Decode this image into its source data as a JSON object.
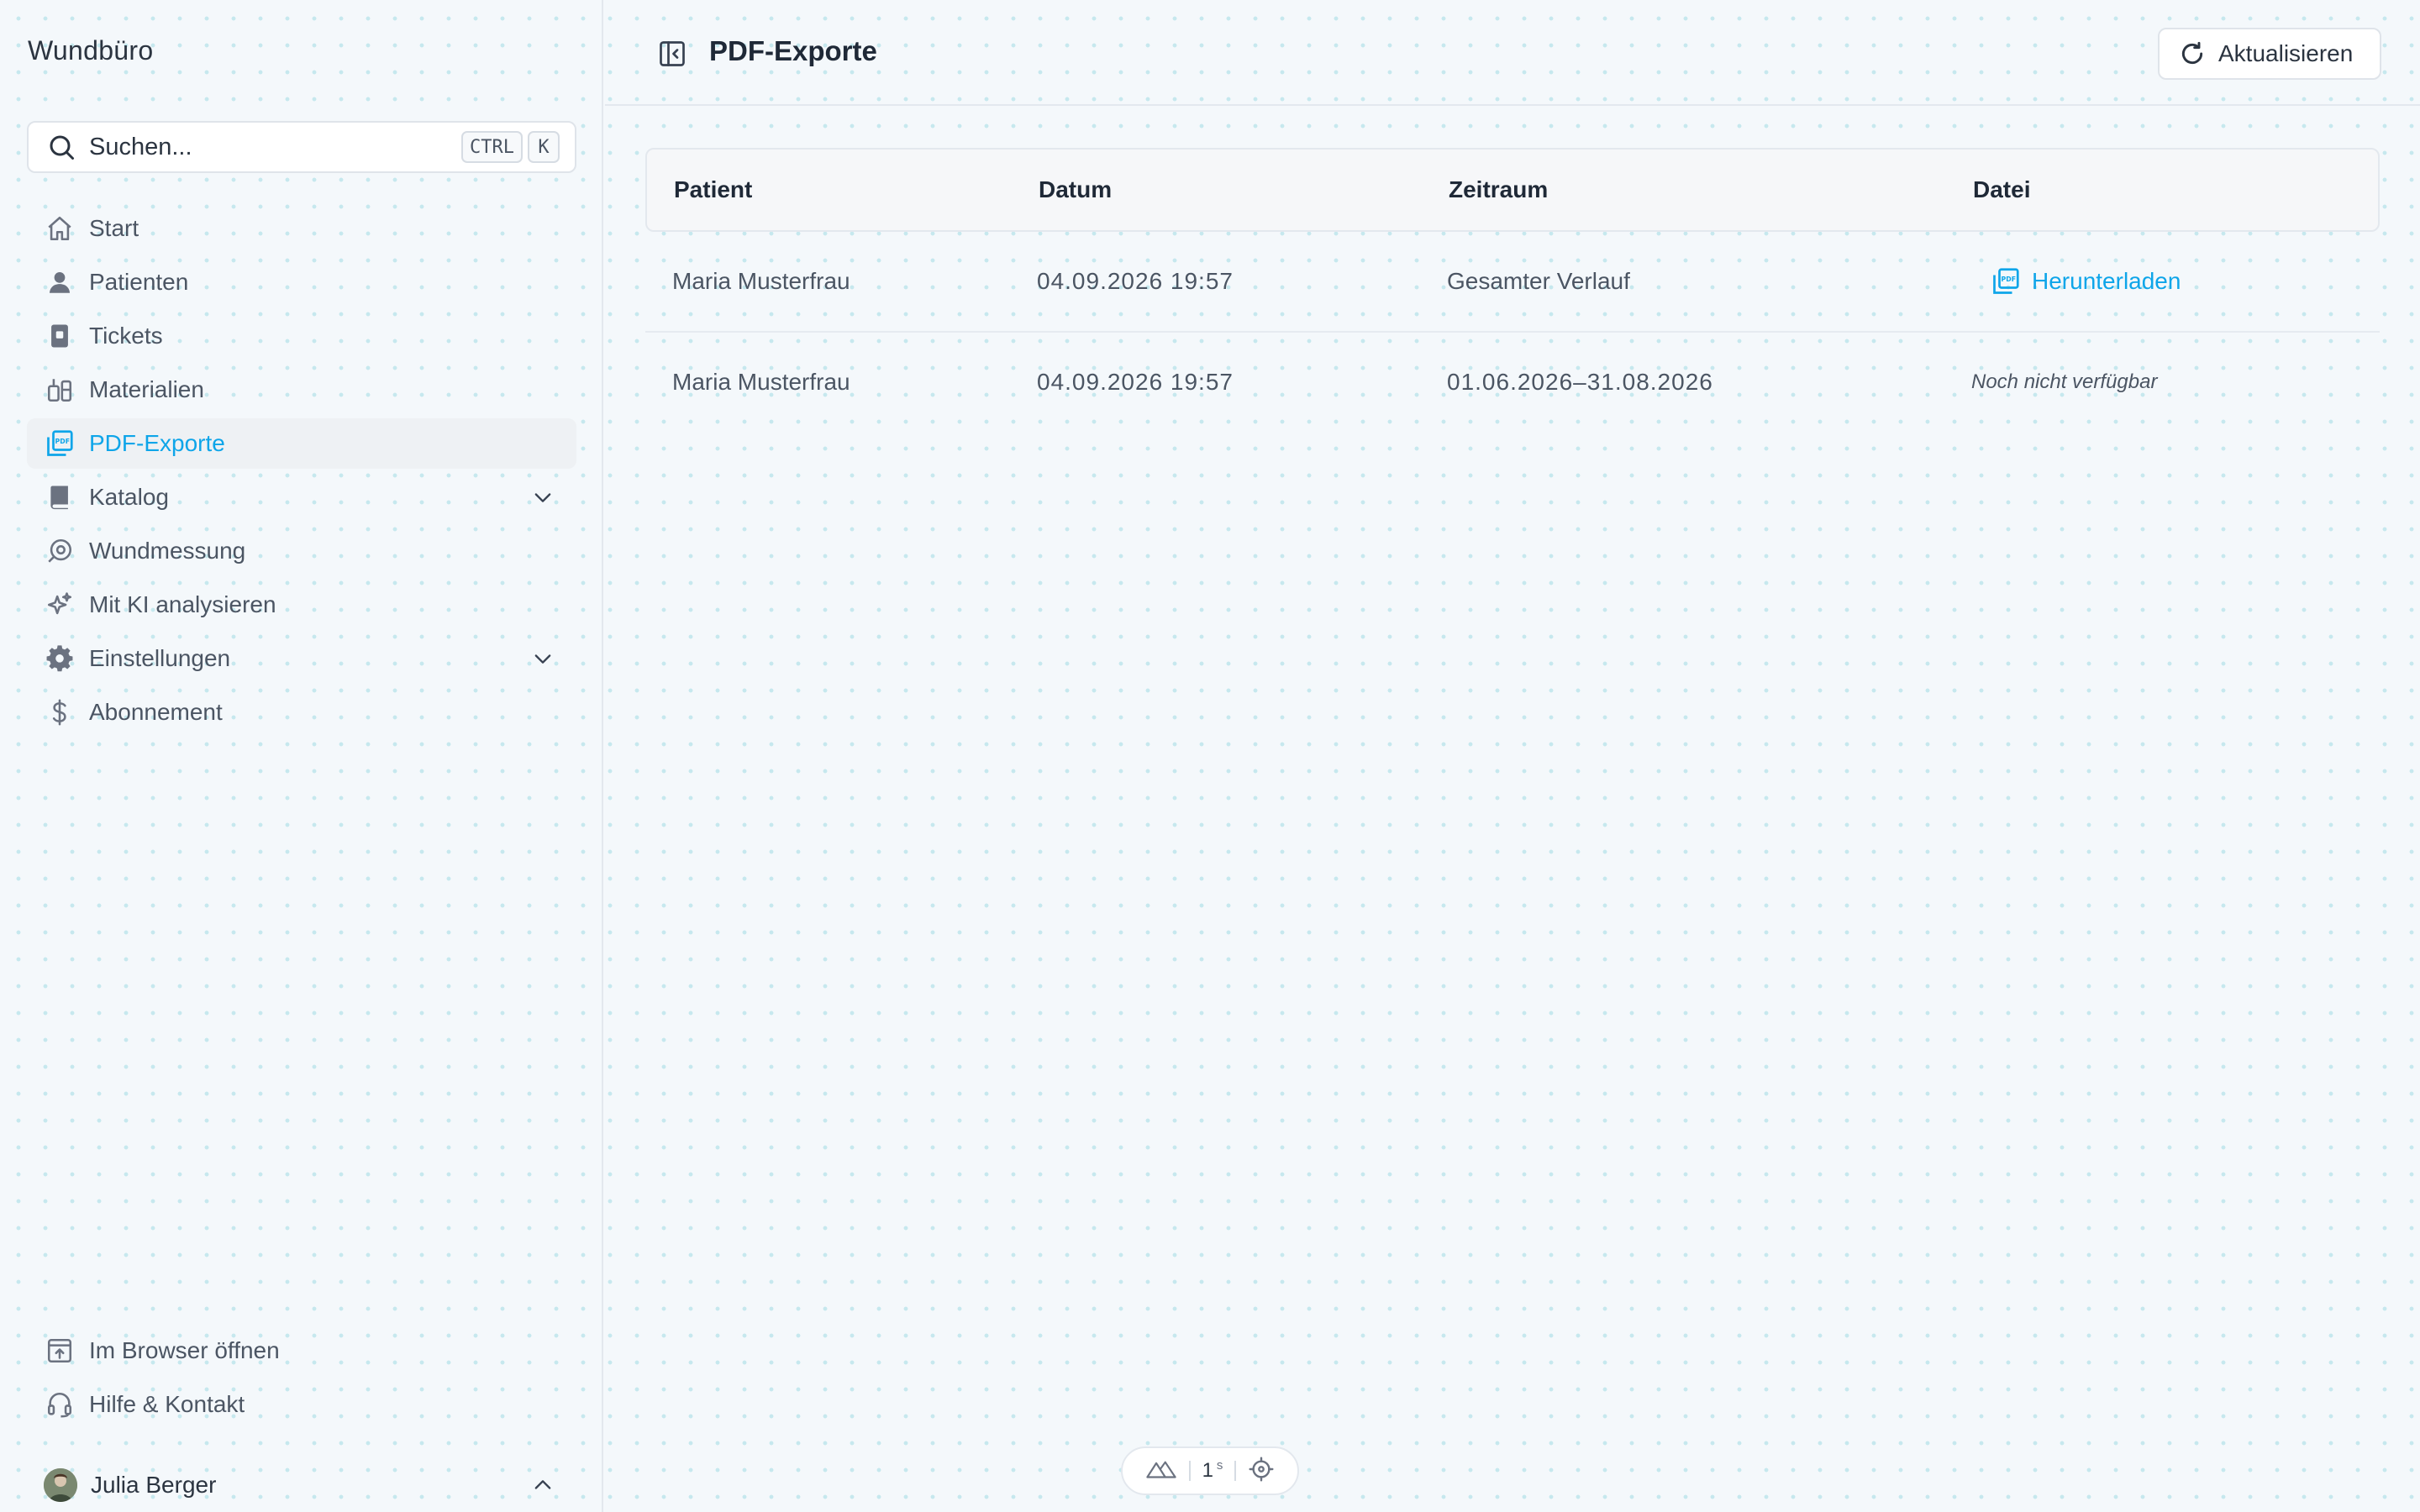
{
  "app": {
    "title": "Wundbüro"
  },
  "search": {
    "placeholder": "Suchen...",
    "shortcut_mod": "CTRL",
    "shortcut_key": "K"
  },
  "sidebar": {
    "items": [
      {
        "label": "Start",
        "icon": "home-icon"
      },
      {
        "label": "Patienten",
        "icon": "user-icon"
      },
      {
        "label": "Tickets",
        "icon": "ticket-icon"
      },
      {
        "label": "Materialien",
        "icon": "materials-icon"
      },
      {
        "label": "PDF-Exporte",
        "icon": "pdf-icon",
        "active": true
      },
      {
        "label": "Katalog",
        "icon": "book-icon",
        "expandable": true
      },
      {
        "label": "Wundmessung",
        "icon": "measure-icon"
      },
      {
        "label": "Mit KI analysieren",
        "icon": "sparkles-icon"
      },
      {
        "label": "Einstellungen",
        "icon": "gear-icon",
        "expandable": true
      },
      {
        "label": "Abonnement",
        "icon": "dollar-icon"
      }
    ],
    "footer": [
      {
        "label": "Im Browser öffnen",
        "icon": "open-browser-icon"
      },
      {
        "label": "Hilfe & Kontakt",
        "icon": "headset-icon"
      }
    ],
    "user": {
      "name": "Julia Berger"
    }
  },
  "header": {
    "title": "PDF-Exporte",
    "refresh_label": "Aktualisieren"
  },
  "table": {
    "columns": [
      "Patient",
      "Datum",
      "Zeitraum",
      "Datei"
    ],
    "rows": [
      {
        "patient": "Maria Musterfrau",
        "datum": "04.09.2026 19:57",
        "zeitraum": "Gesamter Verlauf",
        "datei": "Herunterladen",
        "available": true
      },
      {
        "patient": "Maria Musterfrau",
        "datum": "04.09.2026 19:57",
        "zeitraum": "01.06.2026–31.08.2026",
        "datei": "Noch nicht verfügbar",
        "available": false
      }
    ]
  },
  "status": {
    "value": "1",
    "unit": "s"
  },
  "colors": {
    "accent": "#0ea5e9",
    "text": "#2b3440",
    "muted": "#4b5563",
    "border": "#e3e8ee"
  }
}
